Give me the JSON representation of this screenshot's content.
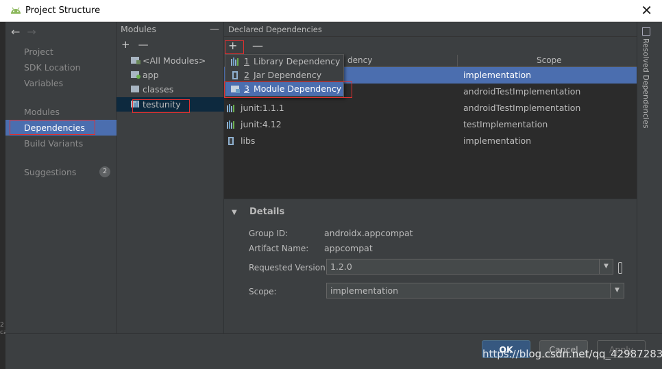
{
  "window": {
    "title": "Project Structure",
    "close_glyph": "✕"
  },
  "left_sliver": {
    "text": "2\nca"
  },
  "sidebar": {
    "back_glyph": "←",
    "forward_glyph": "→",
    "items": [
      {
        "label": "Project"
      },
      {
        "label": "SDK Location"
      },
      {
        "label": "Variables"
      },
      {
        "label": "Modules"
      },
      {
        "label": "Dependencies"
      },
      {
        "label": "Build Variants"
      },
      {
        "label": "Suggestions"
      }
    ],
    "suggestions_count": "2"
  },
  "modules": {
    "header": "Modules",
    "collapse_glyph": "—",
    "add_glyph": "+",
    "remove_glyph": "—",
    "items": [
      {
        "label": "<All Modules>"
      },
      {
        "label": "app"
      },
      {
        "label": "classes"
      },
      {
        "label": "testunity"
      }
    ]
  },
  "declared": {
    "header": "Declared Dependencies",
    "add_glyph": "+",
    "remove_glyph": "—",
    "columns": {
      "dependency": "Dependency",
      "dependency_visible": "dency",
      "scope": "Scope"
    },
    "rows": [
      {
        "name": "",
        "scope": "implementation"
      },
      {
        "name": "",
        "scope": "androidTestImplementation"
      },
      {
        "name": "junit:1.1.1",
        "scope": "androidTestImplementation"
      },
      {
        "name": "junit:4.12",
        "scope": "testImplementation"
      },
      {
        "name": "libs",
        "scope": "implementation"
      }
    ]
  },
  "add_menu": {
    "items": [
      {
        "num": "1",
        "label": "Library Dependency"
      },
      {
        "num": "2",
        "label": "Jar Dependency"
      },
      {
        "num": "3",
        "label": "Module Dependency"
      }
    ]
  },
  "details": {
    "title": "Details",
    "group_label": "Group ID:",
    "group_value": "androidx.appcompat",
    "artifact_label": "Artifact Name:",
    "artifact_value": "appcompat",
    "version_label": "Requested Version:",
    "version_value": "1.2.0",
    "scope_label": "Scope:",
    "scope_value": "implementation"
  },
  "resolved_tab": {
    "label": "Resolved Dependencies"
  },
  "footer": {
    "ok": "OK",
    "cancel": "Cancel",
    "apply": "Apply"
  },
  "watermark": "https://blog.csdn.net/qq_42987283",
  "colors": {
    "selection": "#4b6eaf",
    "highlight_outline": "#e03030",
    "background": "#3c3f41"
  }
}
